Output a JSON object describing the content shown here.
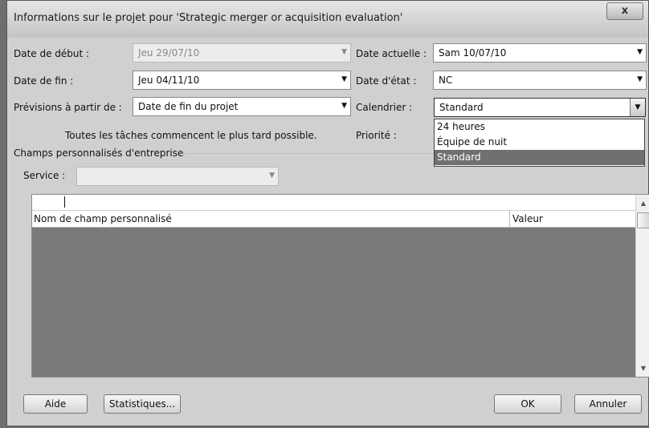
{
  "window": {
    "title": "Informations sur le projet pour 'Strategic merger or acquisition evaluation'",
    "close_label": "x"
  },
  "fields": {
    "start_date": {
      "label": "Date de début :",
      "value": "Jeu 29/07/10"
    },
    "current_date": {
      "label": "Date actuelle :",
      "value": "Sam 10/07/10"
    },
    "finish_date": {
      "label": "Date de fin :",
      "value": "Jeu 04/11/10"
    },
    "status_date": {
      "label": "Date d'état :",
      "value": "NC"
    },
    "schedule_from": {
      "label": "Prévisions à partir de :",
      "value": "Date de fin du projet"
    },
    "calendar": {
      "label": "Calendrier :",
      "value": "Standard"
    },
    "schedule_note": "Toutes les tâches commencent le plus tard possible.",
    "priority": {
      "label": "Priorité :"
    }
  },
  "calendar_dropdown": {
    "options": [
      "24 heures",
      "Équipe de nuit",
      "Standard"
    ],
    "selected": "Standard"
  },
  "enterprise": {
    "group_label": "Champs personnalisés d'entreprise",
    "service_label": "Service :",
    "service_value": ""
  },
  "grid": {
    "columns": [
      "Nom de champ personnalisé",
      "Valeur"
    ]
  },
  "buttons": {
    "help": "Aide",
    "statistics": "Statistiques...",
    "ok": "OK",
    "cancel": "Annuler"
  }
}
